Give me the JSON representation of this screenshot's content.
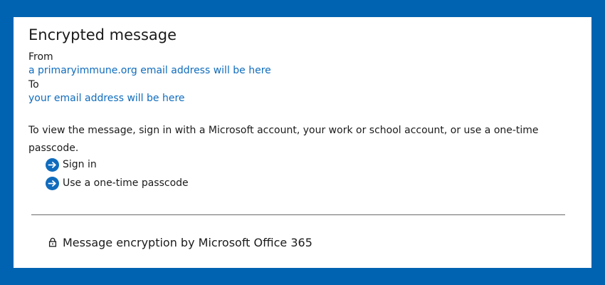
{
  "message": {
    "title": "Encrypted message",
    "from_label": "From",
    "from_value": "a primaryimmune.org email address will be here",
    "to_label": "To",
    "to_value": "your email address will be here",
    "instructions": "To view the message, sign in with a Microsoft account, your work or school account, or use a one-time passcode."
  },
  "actions": {
    "sign_in": {
      "label": "Sign in",
      "icon": "arrow-right-circle-icon"
    },
    "passcode": {
      "label": "Use a one-time passcode",
      "icon": "arrow-right-circle-icon"
    }
  },
  "footer": {
    "text": "Message encryption by Microsoft Office 365",
    "icon": "lock-icon"
  },
  "colors": {
    "frame": "#0063b1",
    "link": "#0f6cbd",
    "card": "#ffffff"
  }
}
